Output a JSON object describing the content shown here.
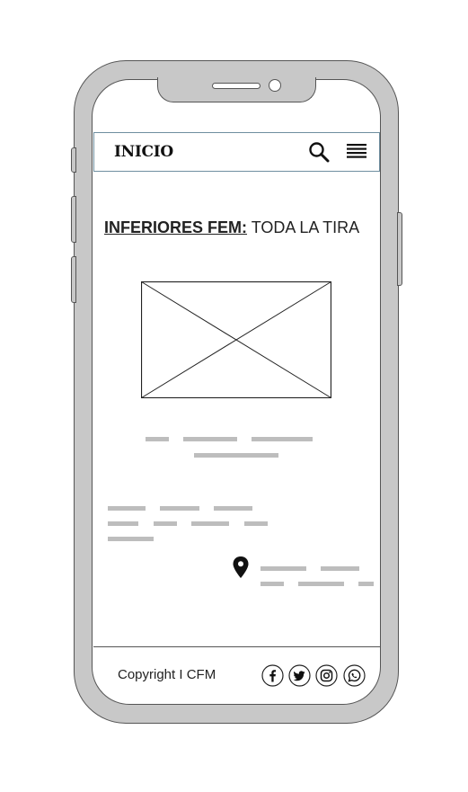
{
  "header": {
    "title": "INICIO"
  },
  "icons": {
    "search": "search-icon",
    "menu": "hamburger-menu-icon",
    "location": "location-pin-icon"
  },
  "headline": {
    "strong": "INFERIORES FEM:",
    "rest": " TODA LA TIRA"
  },
  "footer": {
    "copyright": "Copyright I CFM",
    "social": [
      "facebook-icon",
      "twitter-icon",
      "instagram-icon",
      "whatsapp-icon"
    ]
  },
  "colors": {
    "frame": "#c8c8c8",
    "outline": "#555555",
    "text_placeholder": "#bdbdbd",
    "nav_border": "#6f8fa0"
  }
}
